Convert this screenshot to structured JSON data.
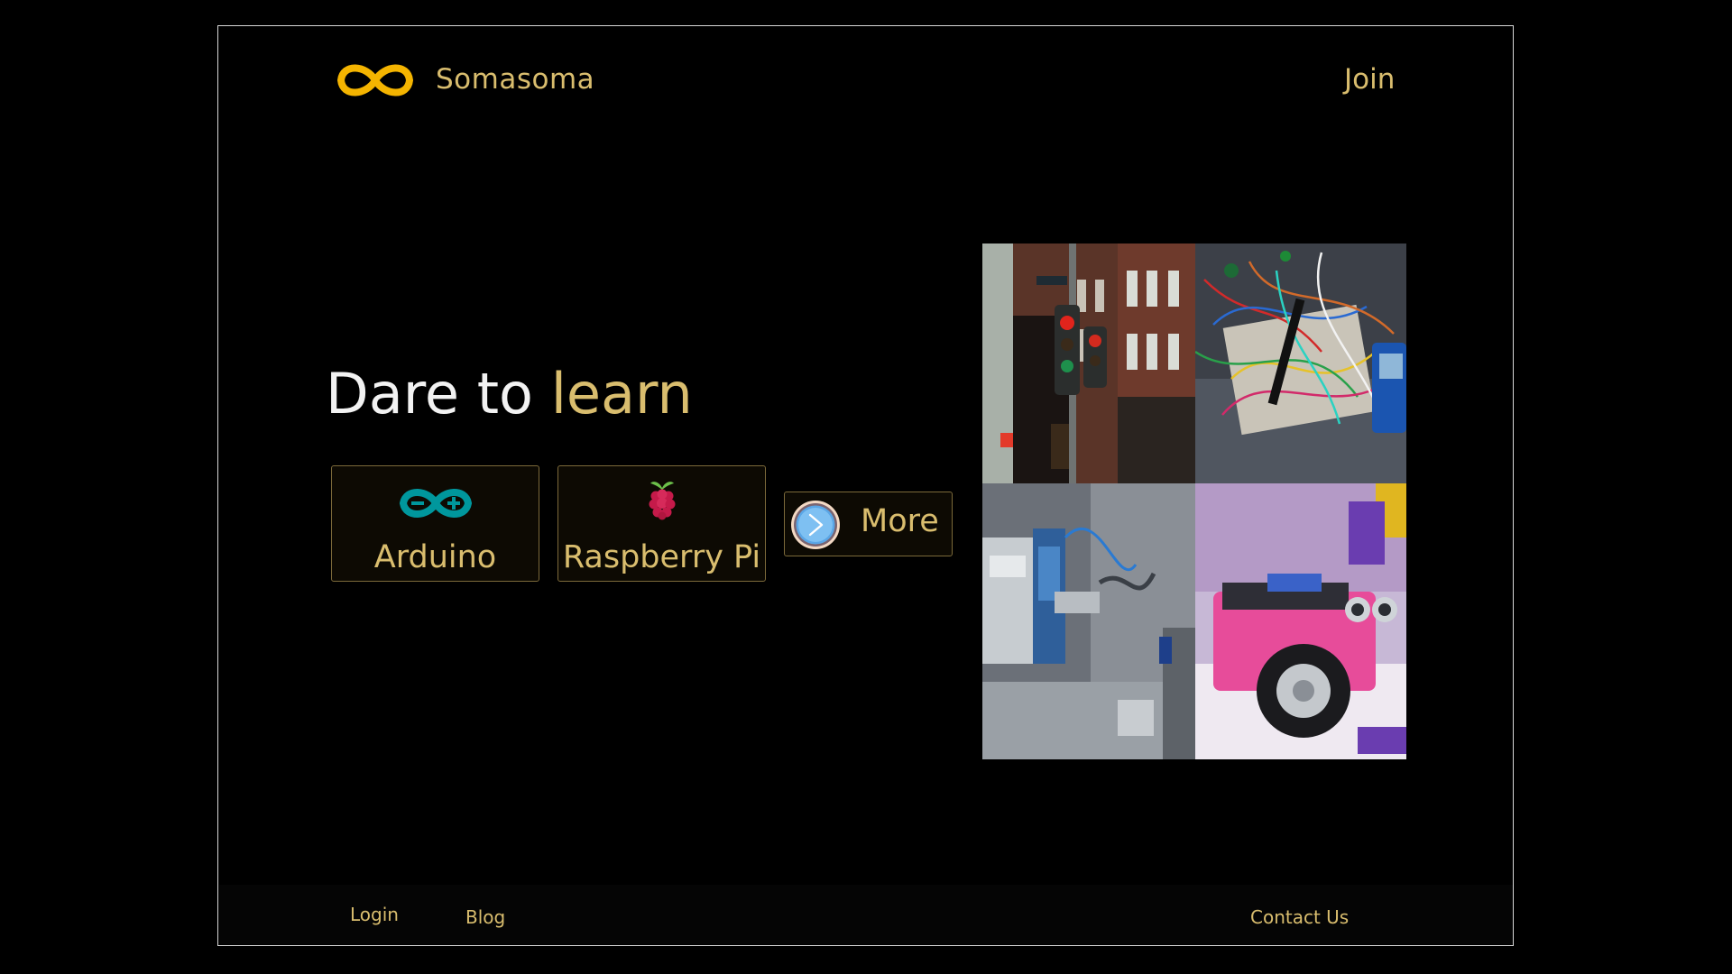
{
  "header": {
    "brand": "Somasoma",
    "logo_icon": "infinity-logo-icon",
    "join_label": "Join"
  },
  "hero": {
    "headline_prefix": "Dare to",
    "headline_highlight": "learn"
  },
  "cards": [
    {
      "label": "Arduino",
      "icon": "arduino-icon"
    },
    {
      "label": "Raspberry Pi",
      "icon": "raspberry-pi-icon"
    },
    {
      "label": "More",
      "icon": "arrow-right-circle-icon"
    }
  ],
  "gallery": [
    {
      "subject": "traffic-lights-street-photo"
    },
    {
      "subject": "breadboard-wires-photo"
    },
    {
      "subject": "robotic-arm-machine-photo"
    },
    {
      "subject": "robot-car-photo"
    }
  ],
  "footer": {
    "links": [
      "Login",
      "Blog",
      "Contact Us"
    ]
  },
  "colors": {
    "accent": "#d9bd6e",
    "logo": "#f4b400",
    "background": "#000000",
    "card_bg": "#0d0a03",
    "card_border": "#7c6a3a",
    "arduino": "#00979d",
    "raspberry": "#c51a4a"
  }
}
